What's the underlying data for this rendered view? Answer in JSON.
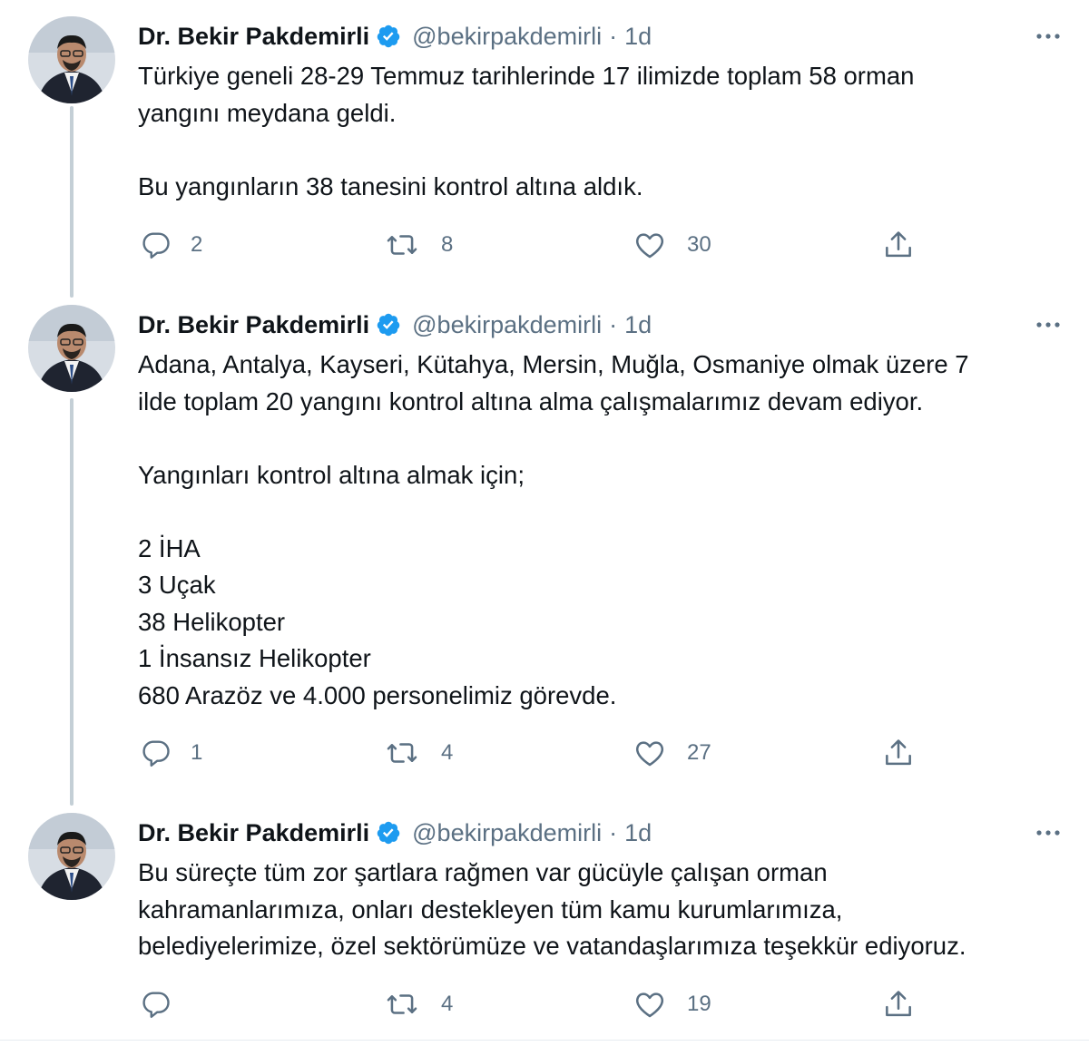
{
  "tweets": [
    {
      "author": "Dr. Bekir Pakdemirli",
      "handle": "@bekirpakdemirli",
      "separator": "·",
      "time": "1d",
      "lines": [
        "Türkiye geneli 28-29 Temmuz tarihlerinde 17 ilimizde toplam 58 orman",
        "yangını meydana geldi.",
        "",
        "Bu yangınların 38 tanesini kontrol altına aldık."
      ],
      "replies": "2",
      "retweets": "8",
      "likes": "30"
    },
    {
      "author": "Dr. Bekir Pakdemirli",
      "handle": "@bekirpakdemirli",
      "separator": "·",
      "time": "1d",
      "lines": [
        "Adana, Antalya, Kayseri, Kütahya, Mersin, Muğla, Osmaniye olmak üzere 7",
        "ilde toplam 20 yangını kontrol altına alma çalışmalarımız devam ediyor.",
        "",
        "Yangınları kontrol altına almak için;",
        "",
        "2 İHA",
        "3 Uçak",
        "38 Helikopter",
        "1 İnsansız Helikopter",
        "680 Arazöz ve 4.000 personelimiz görevde."
      ],
      "replies": "1",
      "retweets": "4",
      "likes": "27"
    },
    {
      "author": "Dr. Bekir Pakdemirli",
      "handle": "@bekirpakdemirli",
      "separator": "·",
      "time": "1d",
      "lines": [
        "Bu süreçte tüm zor şartlara rağmen var gücüyle çalışan orman",
        "kahramanlarımıza, onları destekleyen tüm kamu kurumlarımıza,",
        "belediyelerimize, özel sektörümüze ve vatandaşlarımıza teşekkür ediyoruz."
      ],
      "replies": "",
      "retweets": "4",
      "likes": "19"
    }
  ],
  "icons": {
    "verified": "verified-badge-icon",
    "more": "more-options-icon",
    "reply": "reply-icon",
    "retweet": "retweet-icon",
    "like": "like-icon",
    "share": "share-icon"
  },
  "colors": {
    "text": "#0f1419",
    "secondary": "#5b7083",
    "verified": "#1d9bf0",
    "thread_line": "#c4cfd6"
  }
}
